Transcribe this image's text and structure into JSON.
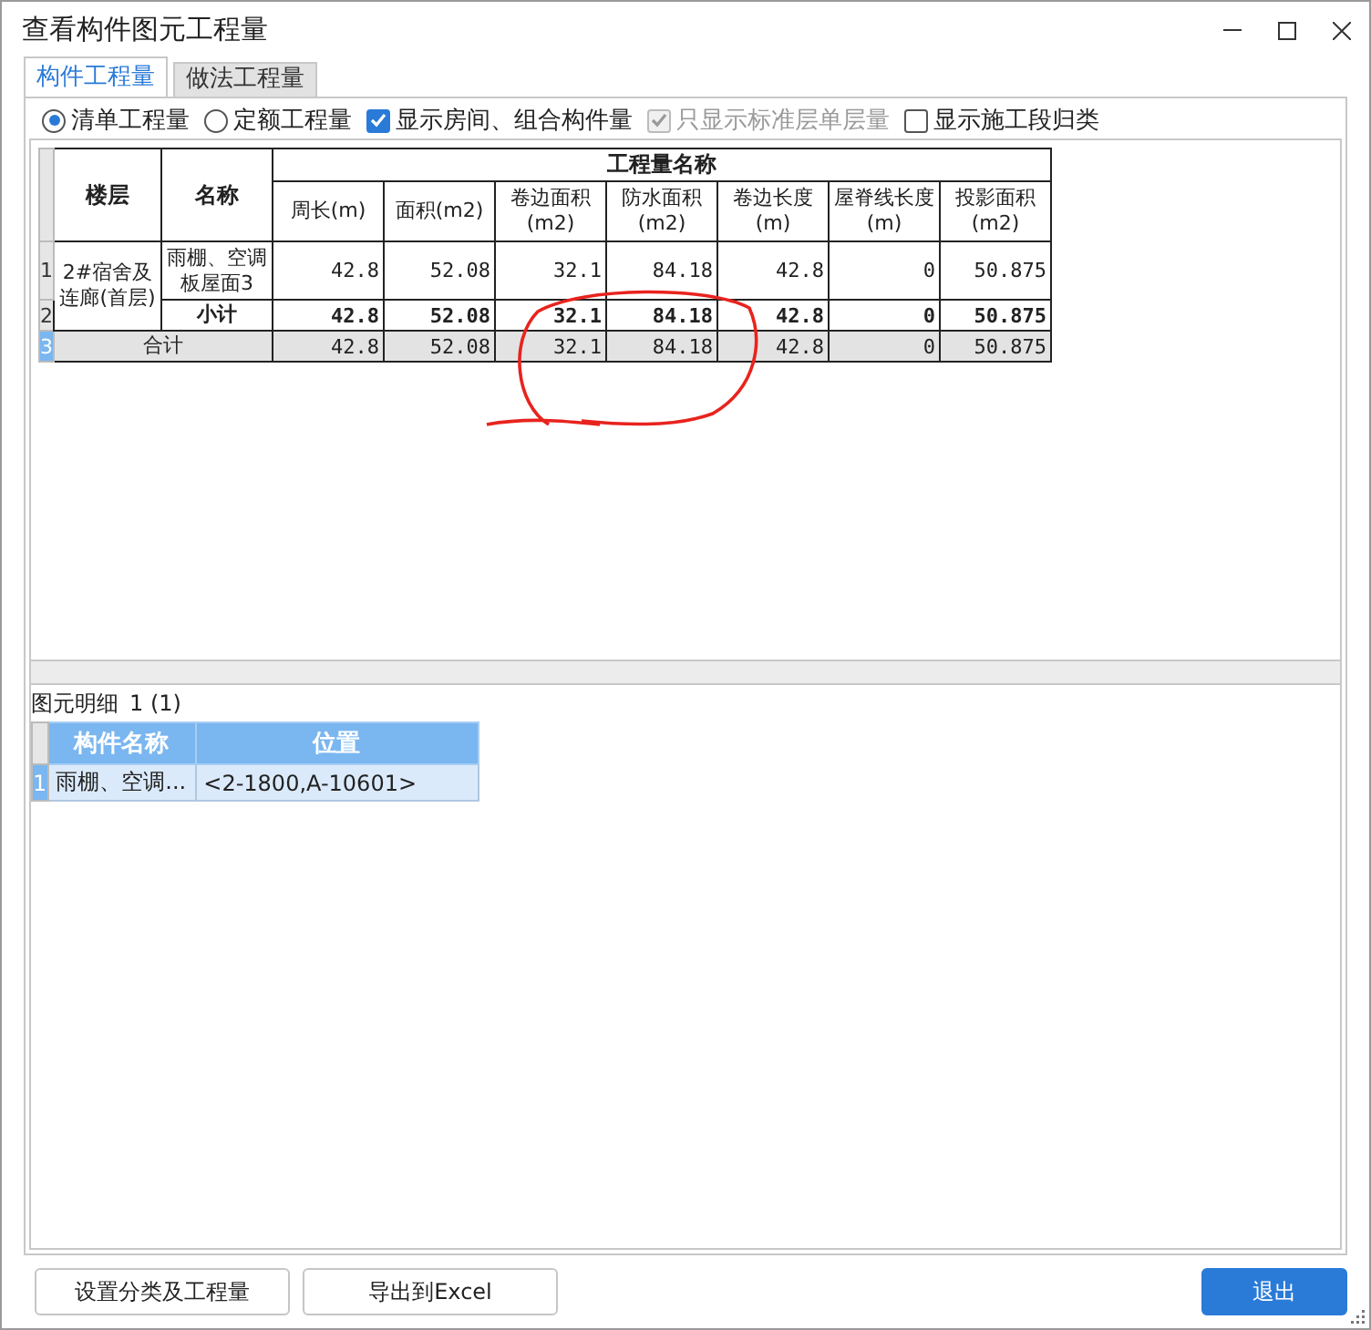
{
  "window": {
    "title": "查看构件图元工程量"
  },
  "tabs": [
    {
      "label": "构件工程量",
      "selected": true
    },
    {
      "label": "做法工程量",
      "selected": false
    }
  ],
  "options": [
    {
      "kind": "radio",
      "label": "清单工程量",
      "selected": true,
      "disabled": false
    },
    {
      "kind": "radio",
      "label": "定额工程量",
      "selected": false,
      "disabled": false
    },
    {
      "kind": "checkbox",
      "label": "显示房间、组合构件量",
      "checked": true,
      "disabled": false
    },
    {
      "kind": "checkbox",
      "label": "只显示标准层单层量",
      "checked": true,
      "disabled": true
    },
    {
      "kind": "checkbox",
      "label": "显示施工段归类",
      "checked": false,
      "disabled": false
    }
  ],
  "table": {
    "group_header": "工程量名称",
    "columns": [
      "楼层",
      "名称",
      "周长(m)",
      "面积(m2)",
      "卷边面积(m2)",
      "防水面积(m2)",
      "卷边长度(m)",
      "屋脊线长度(m)",
      "投影面积(m2)"
    ],
    "rows": [
      {
        "kind": "item",
        "row_number": "1",
        "floor": "2#宿舍及连廊(首层)",
        "name": "雨棚、空调板屋面3",
        "values": [
          "42.8",
          "52.08",
          "32.1",
          "84.18",
          "42.8",
          "0",
          "50.875"
        ],
        "selected": false
      },
      {
        "kind": "subtotal",
        "row_number": "2",
        "name": "小计",
        "values": [
          "42.8",
          "52.08",
          "32.1",
          "84.18",
          "42.8",
          "0",
          "50.875"
        ],
        "selected": false
      },
      {
        "kind": "total",
        "row_number": "3",
        "name": "合计",
        "values": [
          "42.8",
          "52.08",
          "32.1",
          "84.18",
          "42.8",
          "0",
          "50.875"
        ],
        "selected": true
      }
    ]
  },
  "annotations": [
    {
      "kind": "freehand-circle",
      "color": "#e8231e"
    }
  ],
  "detail": {
    "label": "图元明细",
    "count": "1 (1)",
    "columns": [
      "构件名称",
      "位置"
    ],
    "rows": [
      {
        "row_number": "1",
        "cells": [
          "雨棚、空调...",
          "<2-1800,A-10601>"
        ],
        "selected": true
      }
    ]
  },
  "buttons": [
    {
      "label": "设置分类及工程量",
      "primary": false
    },
    {
      "label": "导出到Excel",
      "primary": false
    },
    {
      "label": "退出",
      "primary": true
    }
  ]
}
